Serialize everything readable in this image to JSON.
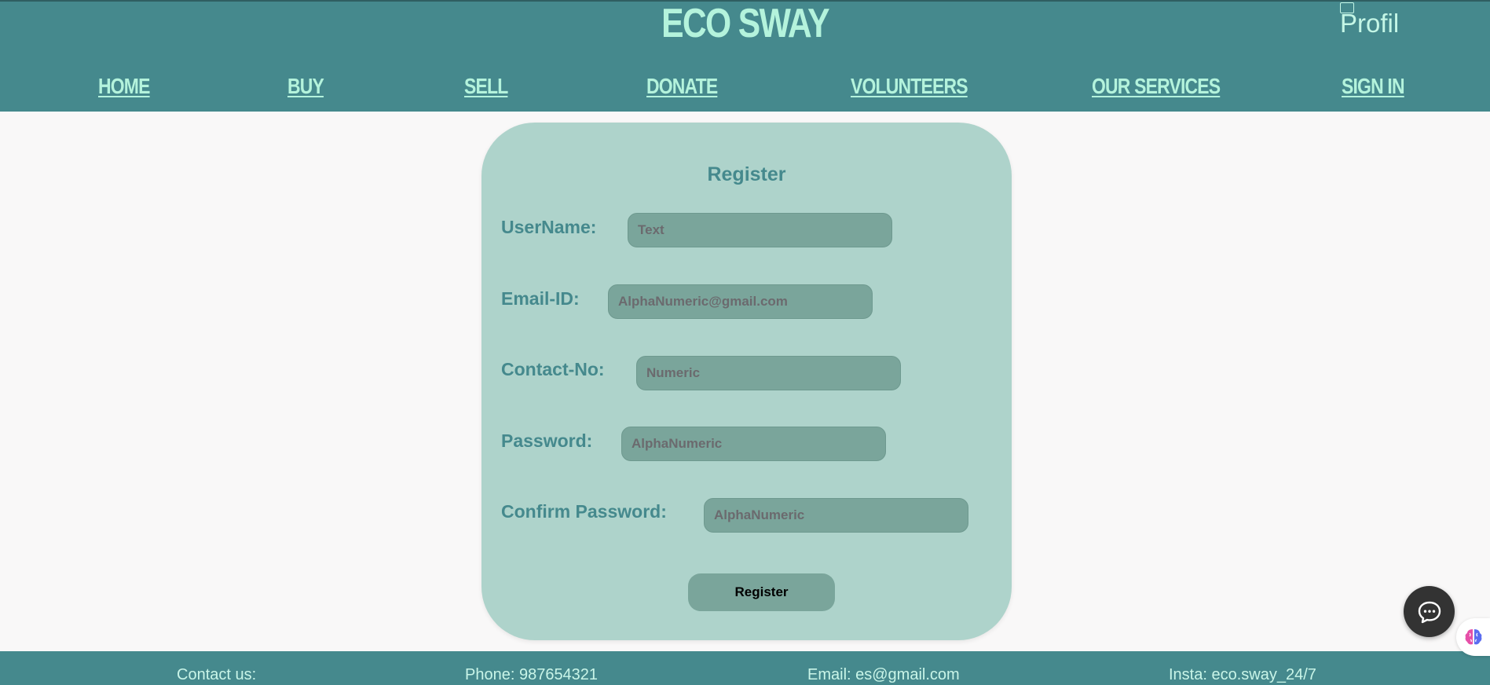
{
  "header": {
    "brand": "ECO SWAY",
    "profile_alt": "Profil",
    "nav": [
      {
        "label": "HOME"
      },
      {
        "label": "BUY"
      },
      {
        "label": "SELL"
      },
      {
        "label": "DONATE"
      },
      {
        "label": "VOLUNTEERS"
      },
      {
        "label": "OUR SERVICES"
      },
      {
        "label": "SIGN IN"
      }
    ]
  },
  "form": {
    "title": "Register",
    "fields": [
      {
        "label": "UserName:",
        "placeholder": "Text",
        "value": ""
      },
      {
        "label": "Email-ID:",
        "placeholder": "AlphaNumeric@gmail.com",
        "value": ""
      },
      {
        "label": "Contact-No:",
        "placeholder": "Numeric",
        "value": ""
      },
      {
        "label": "Password:",
        "placeholder": "AlphaNumeric",
        "value": ""
      },
      {
        "label": "Confirm Password:",
        "placeholder": "AlphaNumeric",
        "value": ""
      }
    ],
    "submit_label": "Register"
  },
  "footer": {
    "contact": "Contact us:",
    "phone": "Phone: 987654321",
    "email": "Email: es@gmail.com",
    "insta": "Insta: eco.sway_24/7"
  },
  "widgets": {
    "chat_icon": "chat-bubble-icon",
    "extension_icon": "brain-icon"
  },
  "colors": {
    "header_bg": "#45898d",
    "brand_text": "#b4f3dc",
    "card_bg": "#aed3cb",
    "field_bg": "#7aa59b",
    "label_text": "#45898d"
  }
}
